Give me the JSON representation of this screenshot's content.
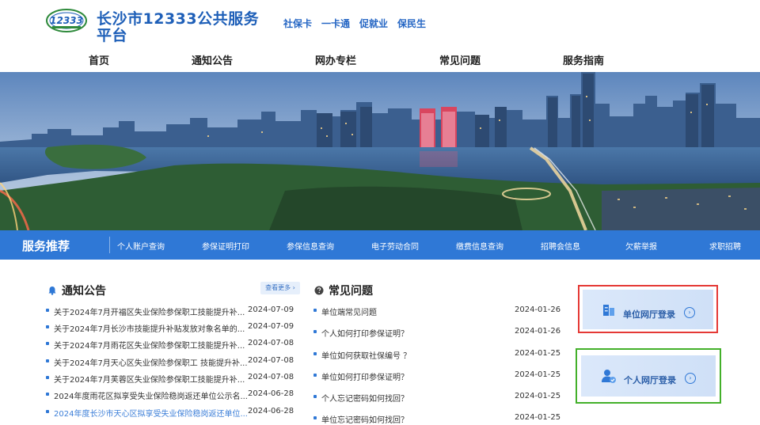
{
  "header": {
    "logo_text": "12333",
    "title": "长沙市12333公共服务平台",
    "slogans": [
      "社保卡",
      "一卡通",
      "促就业",
      "保民生"
    ]
  },
  "nav": [
    "首页",
    "通知公告",
    "网办专栏",
    "常见问题",
    "服务指南"
  ],
  "services": {
    "title": "服务推荐",
    "items": [
      "个人账户查询",
      "参保证明打印",
      "参保信息查询",
      "电子劳动合同",
      "缴费信息查询",
      "招聘会信息",
      "欠薪举报",
      "求职招聘"
    ]
  },
  "notices": {
    "title": "通知公告",
    "more": "查看更多 ›",
    "items": [
      {
        "text": "关于2024年7月开福区失业保险参保职工技能提升补...",
        "date": "2024-07-09"
      },
      {
        "text": "关于2024年7月长沙市技能提升补贴发放对象名单的...",
        "date": "2024-07-09"
      },
      {
        "text": "关于2024年7月雨花区失业保险参保职工技能提升补...",
        "date": "2024-07-08"
      },
      {
        "text": "关于2024年7月天心区失业保险参保职工 技能提升补...",
        "date": "2024-07-08"
      },
      {
        "text": "关于2024年7月芙蓉区失业保险参保职工技能提升补...",
        "date": "2024-07-08"
      },
      {
        "text": "2024年度雨花区拟享受失业保险稳岗返还单位公示名...",
        "date": "2024-06-28"
      },
      {
        "text": "2024年度长沙市天心区拟享受失业保险稳岗返还单位...",
        "date": "2024-06-28"
      }
    ]
  },
  "faq": {
    "title": "常见问题",
    "items": [
      {
        "text": "单位端常见问题",
        "date": "2024-01-26"
      },
      {
        "text": "个人如何打印参保证明？",
        "date": "2024-01-26"
      },
      {
        "text": "单位如何获取社保编号 ？",
        "date": "2024-01-25"
      },
      {
        "text": "单位如何打印参保证明？",
        "date": "2024-01-25"
      },
      {
        "text": "个人忘记密码如何找回？",
        "date": "2024-01-25"
      },
      {
        "text": "单位忘记密码如何找回？",
        "date": "2024-01-25"
      }
    ]
  },
  "login": {
    "unit": "单位网厅登录",
    "personal": "个人网厅登录",
    "unit_border": "#e53935",
    "personal_border": "#43b02a"
  },
  "colors": {
    "brand": "#2f78d6",
    "title": "#1e5fb8"
  }
}
